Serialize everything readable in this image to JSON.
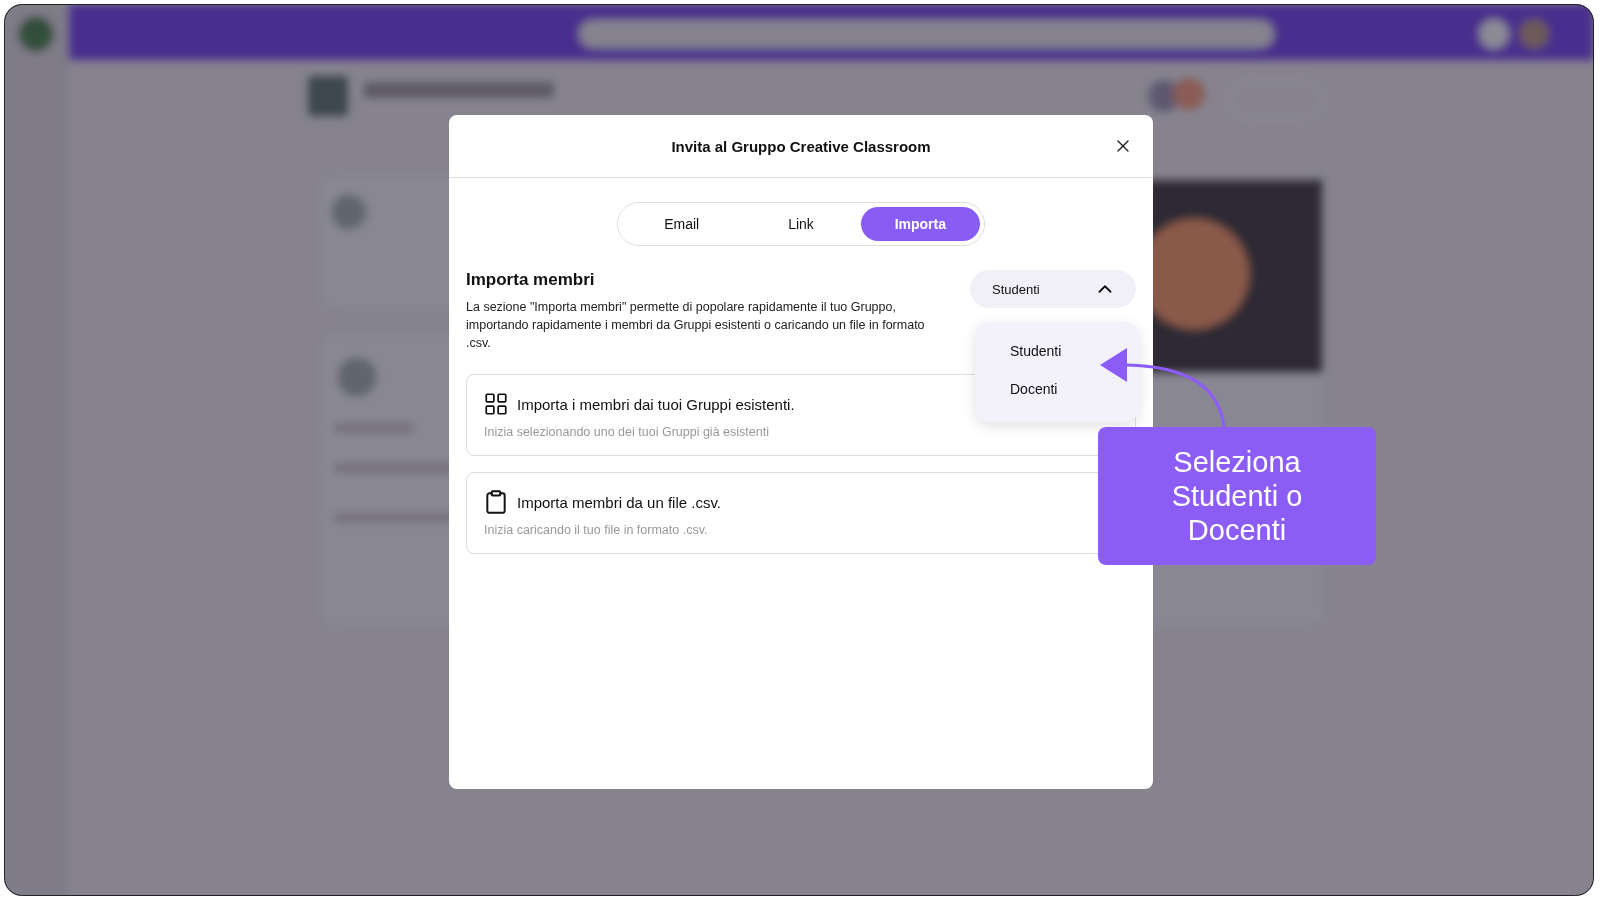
{
  "dialog": {
    "title": "Invita al Gruppo Creative Classroom",
    "tabs": [
      {
        "label": "Email",
        "selected": false
      },
      {
        "label": "Link",
        "selected": false
      },
      {
        "label": "Importa",
        "selected": true
      }
    ],
    "section": {
      "title": "Importa membri",
      "description": "La sezione \"Importa membri\" permette di popolare rapidamente il tuo Gruppo, importando rapidamente i membri da Gruppi esistenti o caricando un file in formato .csv."
    },
    "role_select": {
      "value": "Studenti",
      "expanded": true,
      "options": [
        {
          "label": "Studenti"
        },
        {
          "label": "Docenti"
        }
      ]
    },
    "import_options": [
      {
        "kind": "groups",
        "title": "Importa i membri dai tuoi Gruppi esistenti.",
        "subtitle": "Inizia selezionando uno dei tuoi Gruppi già esistenti"
      },
      {
        "kind": "file",
        "title": "Importa membri da un file .csv.",
        "subtitle": "Inizia caricando il tuo file in formato .csv."
      }
    ]
  },
  "callout": {
    "text": "Seleziona Studenti o Docenti"
  }
}
